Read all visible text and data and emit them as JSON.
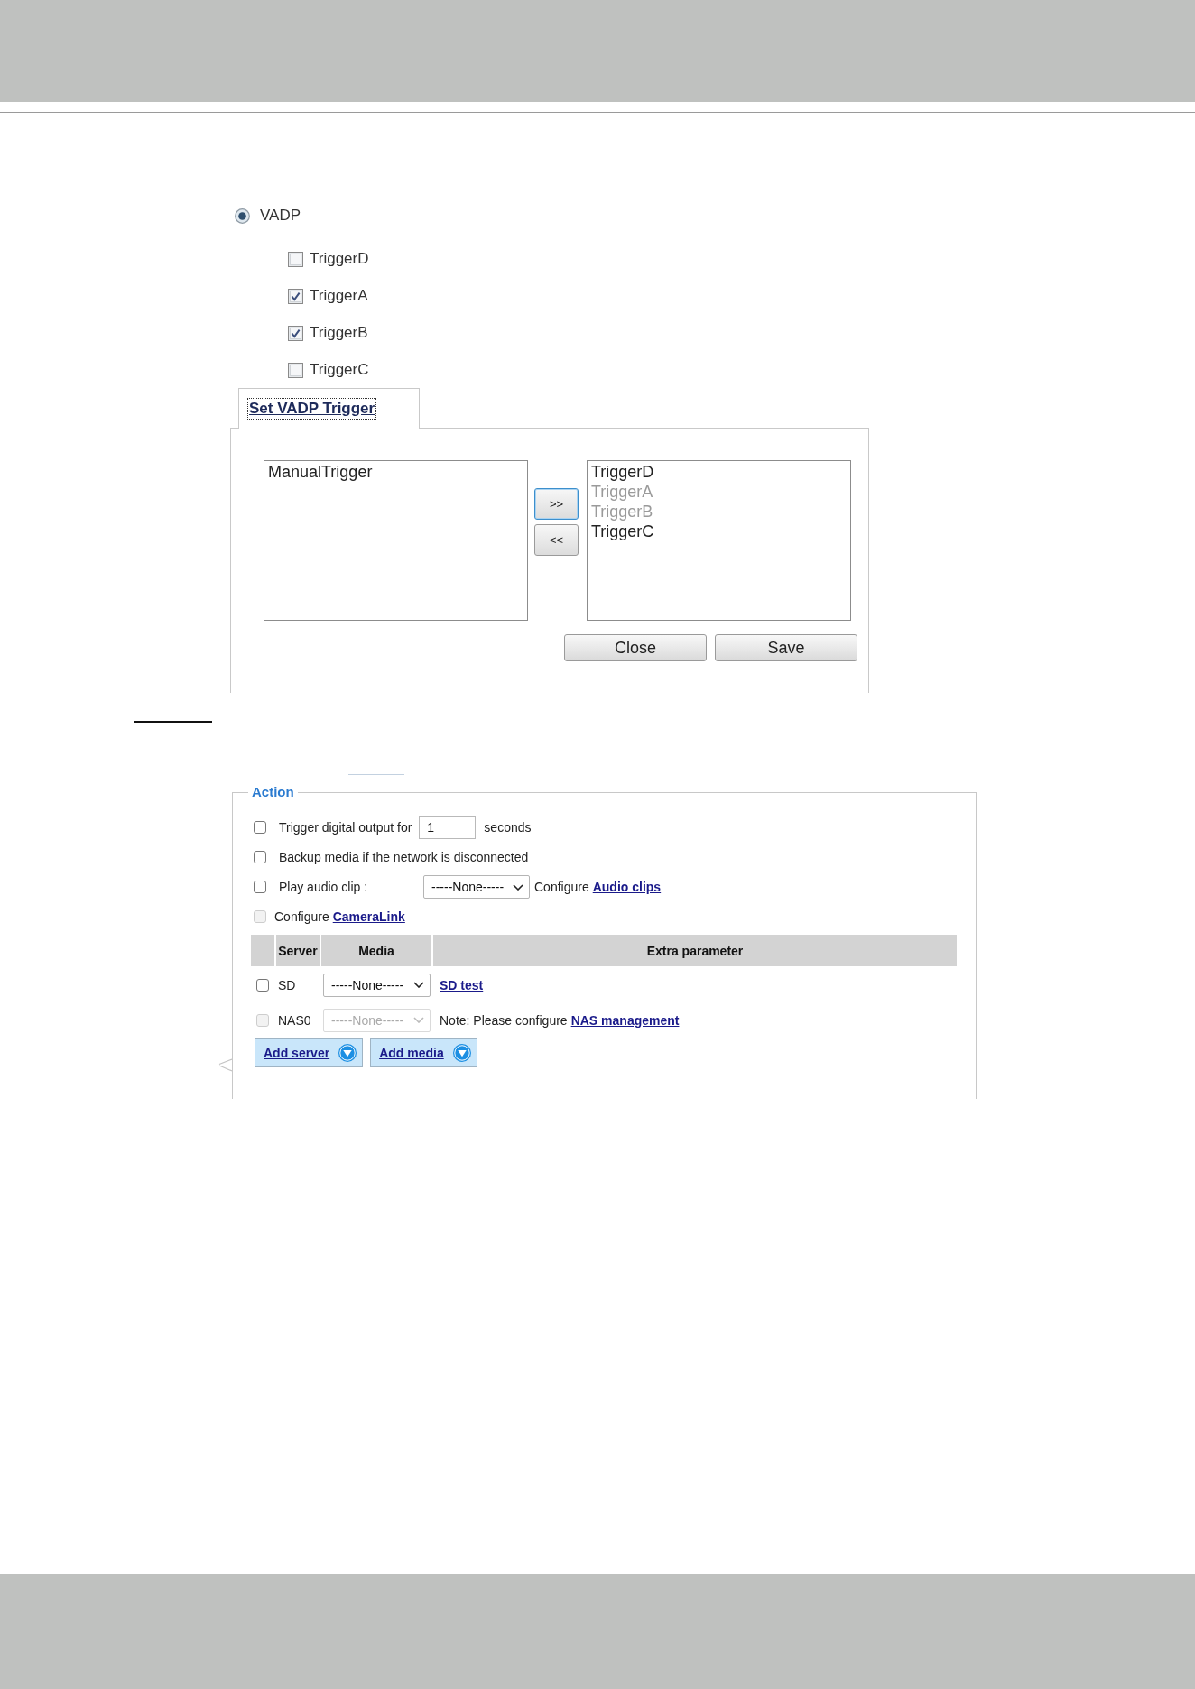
{
  "vadp_option": {
    "label": "VADP",
    "selected": true
  },
  "triggers": [
    {
      "label": "TriggerD",
      "checked": false
    },
    {
      "label": "TriggerA",
      "checked": true
    },
    {
      "label": "TriggerB",
      "checked": true
    },
    {
      "label": "TriggerC",
      "checked": false
    }
  ],
  "trigger_panel": {
    "tab": {
      "label": "Set VADP Trigger",
      "selected": true,
      "focused": true
    },
    "available": [
      {
        "label": "ManualTrigger",
        "disabled": false
      }
    ],
    "move_buttons": [
      {
        "label": ">>",
        "focused": true
      },
      {
        "label": "<<",
        "focused": false
      }
    ],
    "chosen": [
      {
        "label": "TriggerD",
        "disabled": false
      },
      {
        "label": "TriggerA",
        "disabled": true
      },
      {
        "label": "TriggerB",
        "disabled": true
      },
      {
        "label": "TriggerC",
        "disabled": false
      }
    ],
    "buttons": [
      "Close",
      "Save"
    ]
  },
  "action": {
    "legend": "Action",
    "options": [
      {
        "kind": "input",
        "checked": false,
        "disabled": false,
        "label": "Trigger digital output for",
        "value": "1",
        "suffix": "seconds"
      },
      {
        "kind": "plain",
        "checked": false,
        "disabled": false,
        "label": "Backup media if the network is disconnected"
      },
      {
        "kind": "select",
        "checked": false,
        "disabled": false,
        "label": "Play audio clip :",
        "select": "-----None-----",
        "text": "Configure",
        "link": "Audio clips"
      },
      {
        "kind": "link",
        "checked": false,
        "disabled": true,
        "label": "Configure",
        "link": "CameraLink"
      }
    ],
    "table": {
      "columns": [
        "Server",
        "Media",
        "Extra parameter"
      ],
      "rows": [
        {
          "kind": "link",
          "checked": false,
          "disabled": false,
          "server": "SD",
          "media": "-----None-----",
          "link": "SD test"
        },
        {
          "kind": "note",
          "checked": false,
          "disabled": true,
          "server": "NAS0",
          "media": "-----None-----",
          "note": "Note: Please configure",
          "link": "NAS management"
        }
      ]
    },
    "buttons": [
      "Add server",
      "Add media"
    ]
  }
}
